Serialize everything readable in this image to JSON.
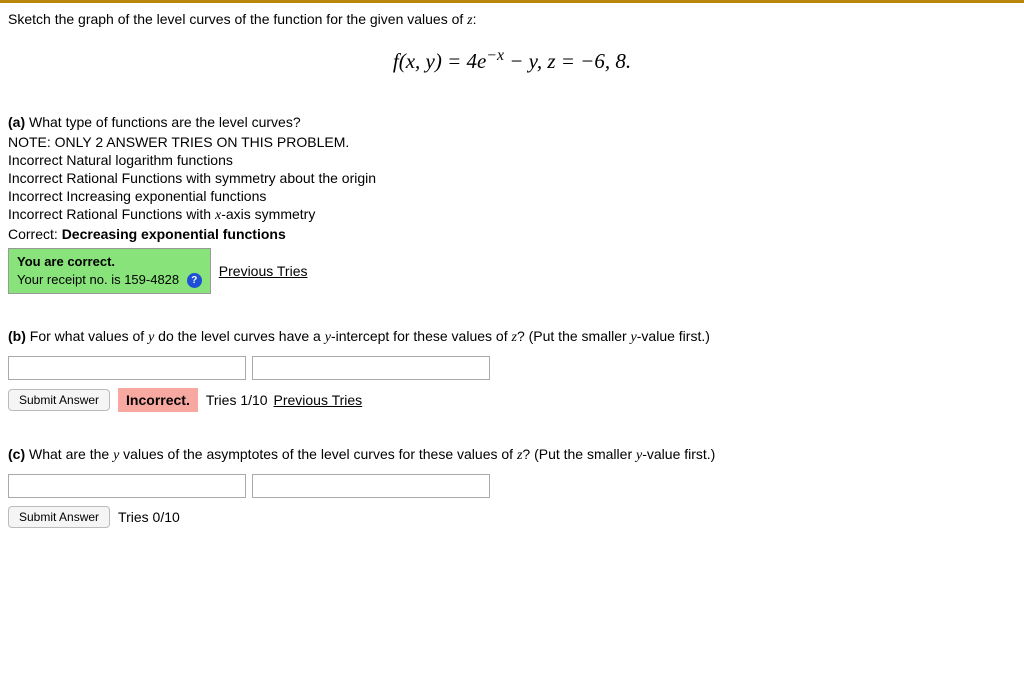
{
  "prompt": "Sketch the graph of the level curves of the function for the given values of ",
  "prompt_var": "z",
  "prompt_colon": ":",
  "equation": {
    "lhs": "f(x, y) = 4e",
    "exp": "−x",
    "mid": " − y,   z = −6, 8.",
    "full_plain": "f(x, y) = 4e^{-x} - y,  z = -6, 8."
  },
  "partA": {
    "label": "(a)",
    "question": " What type of functions are the level curves?",
    "note": "NOTE: ONLY 2 ANSWER TRIES ON THIS PROBLEM.",
    "lines": [
      "Incorrect Natural logarithm functions",
      "Incorrect Rational Functions with symmetry about the origin",
      "Incorrect Increasing exponential functions",
      "Incorrect Rational Functions with x-axis symmetry"
    ],
    "correct_prefix": "Correct: ",
    "correct_answer": "Decreasing exponential functions",
    "feedback_line1": "You are correct.",
    "feedback_line2a": "Your receipt no. is ",
    "feedback_receipt": "159-4828",
    "previous_tries": "Previous Tries"
  },
  "partB": {
    "label": "(b)",
    "question": " For what values of y do the level curves have a y-intercept for these values of z? (Put the smaller y-value first.)",
    "submit": "Submit Answer",
    "incorrect": "Incorrect.",
    "tries": "Tries 1/10",
    "previous_tries": "Previous Tries"
  },
  "partC": {
    "label": "(c)",
    "question": " What are the y values of the asymptotes of the level curves for these values of z? (Put the smaller y-value first.)",
    "submit": "Submit Answer",
    "tries": "Tries 0/10"
  },
  "help_icon": "?"
}
